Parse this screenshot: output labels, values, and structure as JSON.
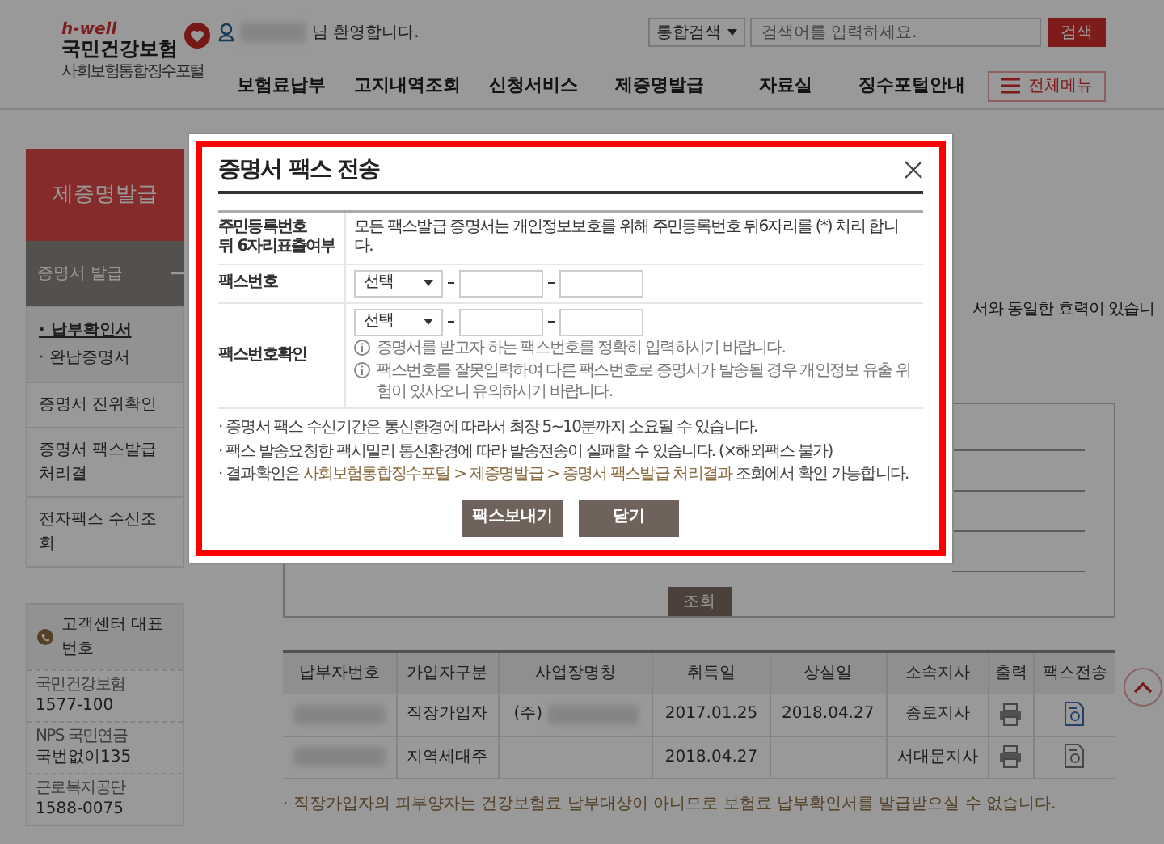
{
  "header": {
    "logo": {
      "tagline": "h-well",
      "name": "국민건강보험",
      "subtitle": "사회보험통합징수포털"
    },
    "welcome": "님 환영합니다.",
    "search": {
      "scope": "통합검색",
      "placeholder": "검색어를 입력하세요.",
      "button": "검색"
    },
    "nav": [
      "보험료납부",
      "고지내역조회",
      "신청서비스",
      "제증명발급",
      "자료실",
      "징수포털안내"
    ],
    "all_menu": "전체메뉴"
  },
  "sidebar": {
    "title": "제증명발급",
    "section": {
      "label": "증명서 발급",
      "expanded": true,
      "children": [
        {
          "label": "· 납부확인서",
          "selected": true
        },
        {
          "label": "· 완납증명서",
          "selected": false
        }
      ]
    },
    "items": [
      "증명서 진위확인",
      "증명서 팩스발급 처리결",
      "전자팩스 수신조회"
    ],
    "contact": {
      "title": "고객센터 대표번호",
      "rows": [
        {
          "org": "국민건강보험",
          "number": "1577-100"
        },
        {
          "org": "NPS 국민연금",
          "number": "국번없이135"
        },
        {
          "org": "근로복지공단",
          "number": "1588-0075"
        }
      ]
    }
  },
  "main": {
    "partial_text": "서와 동일한 효력이 있습니",
    "search_button": "조회",
    "table": {
      "columns": [
        "납부자번호",
        "가입자구분",
        "사업장명칭",
        "취득일",
        "상실일",
        "소속지사",
        "출력",
        "팩스전송"
      ],
      "rows": [
        {
          "member_type": "직장가입자",
          "workplace": "(주)",
          "acquired": "2017.01.25",
          "lost": "2018.04.27",
          "branch": "종로지사",
          "fax_active": true
        },
        {
          "member_type": "지역세대주",
          "acquired": "2018.04.27",
          "branch": "서대문지사",
          "fax_active": false
        }
      ]
    },
    "notes": [
      "· 직장가입자의 피부양자는 건강보험료 납부대상이 아니므로 보험료 납부확인서를 발급받으실 수 없습니다."
    ]
  },
  "modal": {
    "title": "증명서 팩스 전송",
    "form": [
      {
        "kind": "text",
        "label": [
          "주민등록번호",
          "뒤 6자리표출여부"
        ],
        "text": "모든 팩스발급 증명서는 개인정보보호를 위해 주민등록번호 뒤6자리를 (*) 처리 합니다."
      },
      {
        "kind": "fax",
        "label": [
          "팩스번호"
        ],
        "select": "선택"
      },
      {
        "kind": "fax",
        "label": [
          "팩스번호확인"
        ],
        "select": "선택",
        "hints": [
          "증명서를 받고자 하는 팩스번호를 정확히 입력하시기 바랍니다.",
          "팩스번호를 잘못입력하여 다른 팩스번호로 증명서가 발송될 경우 개인정보 유출 위험이 있사오니 유의하시기 바랍니다."
        ]
      }
    ],
    "notes": [
      [
        {
          "text": "· 증명서 팩스 수신기간은 통신환경에 따라서 최장 5~10분까지 소요될 수 있습니다.",
          "highlight": false
        }
      ],
      [
        {
          "text": "· 팩스 발송요청한 팩시밀리 통신환경에 따라 발송전송이 실패할 수 있습니다. (×해외팩스 불가)",
          "highlight": false
        }
      ],
      [
        {
          "text": "· 결과확인은 ",
          "highlight": false
        },
        {
          "text": "사회보험통합징수포털 > 제증명발급 > 증명서 팩스발급 처리결과",
          "highlight": true
        },
        {
          "text": " 조회에서 확인 가능합니다.",
          "highlight": false
        }
      ]
    ],
    "buttons": [
      "팩스보내기",
      "닫기"
    ]
  }
}
